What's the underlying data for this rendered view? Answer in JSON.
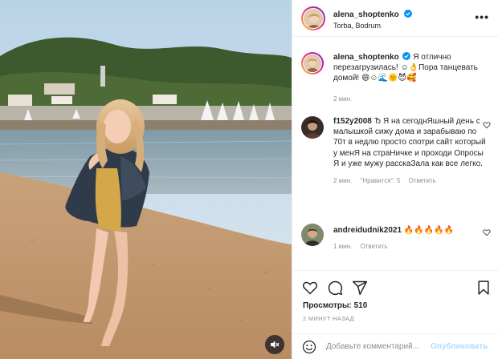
{
  "post": {
    "username": "alena_shoptenko",
    "location": "Torba, Bodrum",
    "caption_text": "Я отлично перезагрузилась! ☺👌Пора танцевать домой! 😄☺🌊🌞😈🥰",
    "caption_time": "2 мин."
  },
  "comments": [
    {
      "username": "f152y2008",
      "text": "Ђ Я на сегоднЯшный день с малышкой сижу дома и зарабываю по 70т в недлю просто спотри сайт который у менЯ на страНичке и проходи Опросы Я и уже мужу расскаЗала как все легко.",
      "time": "2 мин.",
      "likes": "\"Нравится\": 5",
      "reply": "Ответить"
    },
    {
      "username": "andreidudnik2021",
      "text": "🔥🔥🔥🔥🔥",
      "time": "1 мин.",
      "reply": "Ответить"
    }
  ],
  "stats": {
    "views_label": "Просмотры:",
    "views_count": "510",
    "time_ago": "2 МИНУТ НАЗАД"
  },
  "add_comment": {
    "placeholder": "Добавьте комментарий...",
    "publish_label": "Опубликовать"
  },
  "icons": {
    "verified": "verified-badge-icon",
    "more": "more-options-icon",
    "like": "heart-icon",
    "comment": "comment-bubble-icon",
    "share": "paper-plane-icon",
    "save": "bookmark-icon",
    "emoji": "smiley-icon",
    "mute": "speaker-mute-icon"
  },
  "colors": {
    "verified_blue": "#0095f6",
    "publish_disabled": "#b3dbff",
    "meta_gray": "#8e8e8e"
  }
}
